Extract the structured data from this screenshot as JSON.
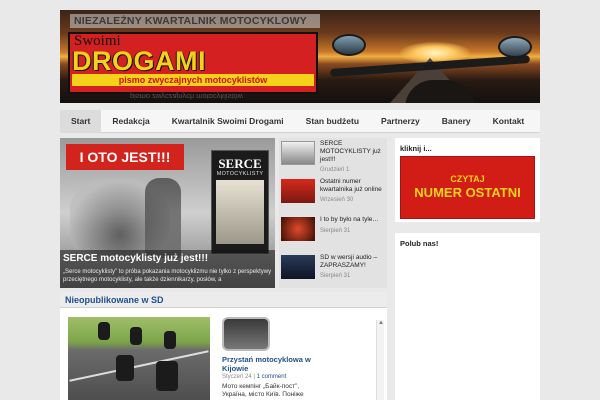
{
  "header": {
    "tagline": "NIEZALEŻNY KWARTALNIK MOTOCYKLOWY",
    "logo_small": "Swoimi",
    "logo_big": "DROGAMI",
    "logo_sub": "pismo zwyczajnych motocyklistów"
  },
  "nav": {
    "items": [
      "Start",
      "Redakcja",
      "Kwartalnik Swoimi Drogami",
      "Stan budżetu",
      "Partnerzy",
      "Banery",
      "Kontakt"
    ]
  },
  "featured": {
    "badge": "I OTO JEST!!!",
    "book_title": "SERCE",
    "book_sub": "MOTOCYKLISTY",
    "title": "SERCE motocyklisty już jest!!!",
    "text": "„Serce motocyklisty” to próba pokazania motocyklizmu nie tylko z perspektywy przeciętnego motocyklisty, ale także dziennikarzy, posłów, a"
  },
  "side_posts": [
    {
      "title": "SERCE MOTOCYKLISTY już jest!!!",
      "date": "Grudzień 1"
    },
    {
      "title": "Ostatni numer kwartalnika już online",
      "date": "Wrzesień 30"
    },
    {
      "title": "I to by było na tyle…",
      "date": "Sierpień 31"
    },
    {
      "title": "SD w wersji audio – ZAPRASZAMY!",
      "date": "Sierpień 31"
    }
  ],
  "np": {
    "title": "Nieopublikowane w SD",
    "card_title": "Przystań motocyklowa w Kijowie",
    "card_date": "Styczeń 24",
    "card_comments": "1 comment",
    "card_text": "Мото кемпінг „Байк-пост”, Україна, місто Київ.   Поніже текст"
  },
  "sidebar": {
    "box1_title": "kliknij i...",
    "banner_line1": "CZYTAJ",
    "banner_line2": "NUMER OSTATNI",
    "box2_title": "Polub nas!"
  }
}
